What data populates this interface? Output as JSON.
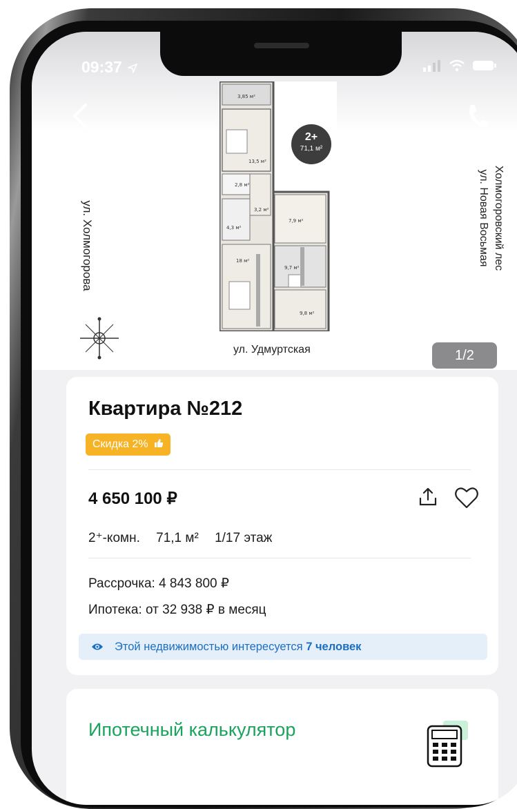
{
  "status_bar": {
    "time": "09:37"
  },
  "plan": {
    "street_left": "ул. Холмогорова",
    "street_right_1": "Холмогоровский лес",
    "street_right_2": "ул. Новая Восьмая",
    "street_bottom": "ул. Удмуртская",
    "badge_rooms": "2+",
    "badge_area": "71,1 м²",
    "room_areas": [
      "3,85 м²",
      "13,5 м²",
      "2,8 м²",
      "3,2 м²",
      "4,3 м²",
      "7,9 м²",
      "18 м²",
      "9,7 м²",
      "9,8 м²"
    ],
    "page_counter": "1/2"
  },
  "listing": {
    "title": "Квартира №212",
    "discount": "Скидка 2%",
    "price": "4 650 100 ₽",
    "rooms": "2⁺-комн.",
    "area": "71,1 м²",
    "floor": "1/17 этаж",
    "installment": "Рассрочка: 4 843 800 ₽",
    "mortgage": "Ипотека: от 32 938 ₽ в месяц",
    "interest_text": "Этой недвижимостью интересуется",
    "interest_count": "7 человек"
  },
  "calculator": {
    "title": "Ипотечный калькулятор"
  },
  "colors": {
    "accent_green": "#1aa35d",
    "discount_yellow": "#f6b325",
    "info_blue": "#1b6ec2"
  },
  "icons": [
    "back-arrow-icon",
    "phone-icon",
    "share-icon",
    "heart-icon",
    "eye-icon",
    "calculator-icon",
    "compass-icon",
    "thumbs-up-icon"
  ]
}
